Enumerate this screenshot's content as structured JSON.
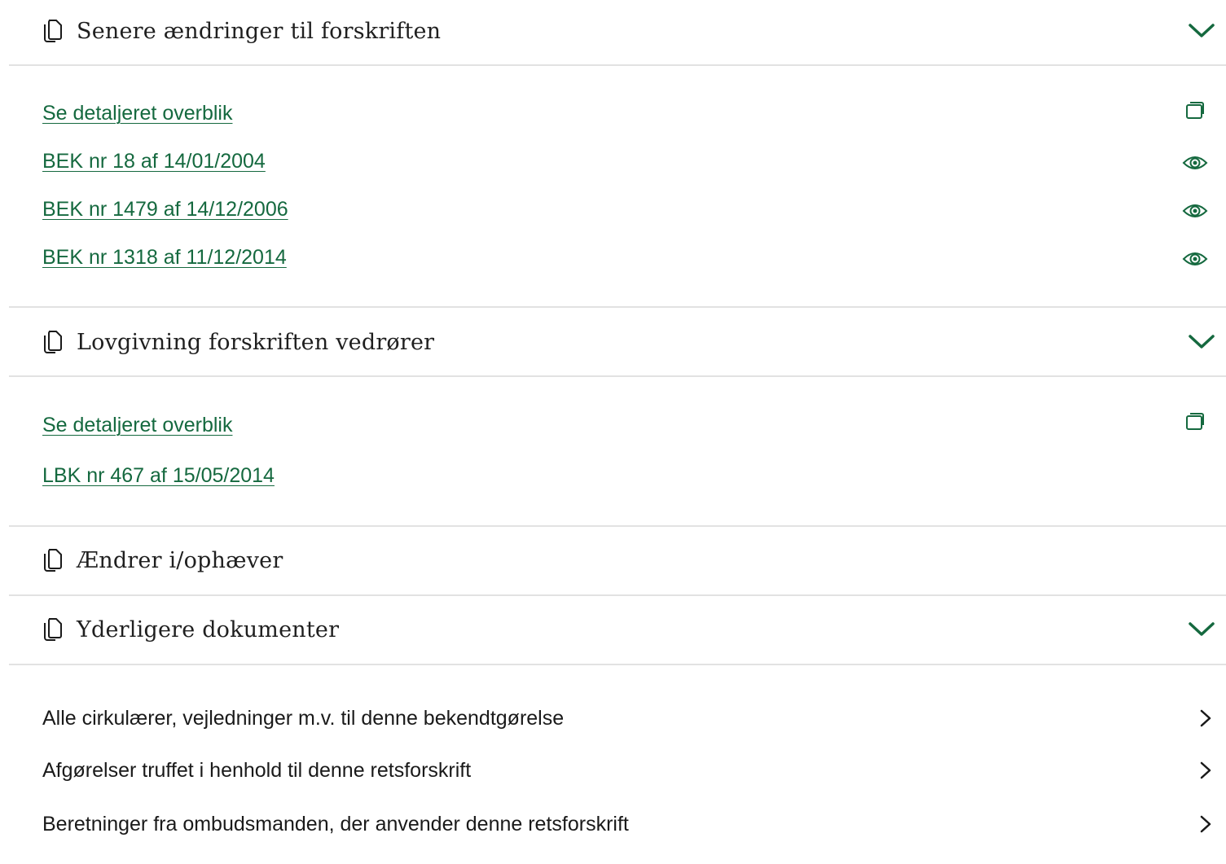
{
  "colors": {
    "accent": "#15693f",
    "divider": "#e2e2e2",
    "text": "#1a1a1a"
  },
  "sections": [
    {
      "title": "Senere ændringer til forskriften",
      "icon": "copy-document-icon",
      "expanded": true,
      "links": [
        {
          "label": "Se detaljeret overblik",
          "icon": "copy-icon"
        },
        {
          "label": "BEK nr 18 af 14/01/2004",
          "icon": "eye-icon"
        },
        {
          "label": "BEK nr 1479 af 14/12/2006",
          "icon": "eye-icon"
        },
        {
          "label": "BEK nr 1318 af 11/12/2014",
          "icon": "eye-icon"
        }
      ]
    },
    {
      "title": "Lovgivning forskriften vedrører",
      "icon": "copy-document-icon",
      "expanded": true,
      "links": [
        {
          "label": "Se detaljeret overblik",
          "icon": "copy-icon"
        },
        {
          "label": "LBK nr 467 af 15/05/2014",
          "icon": ""
        }
      ]
    },
    {
      "title": "Ændrer i/ophæver",
      "icon": "copy-document-icon",
      "expanded": false,
      "links": []
    },
    {
      "title": "Yderligere dokumenter",
      "icon": "copy-document-icon",
      "expanded": true,
      "items": [
        {
          "label": "Alle cirkulærer, vejledninger m.v. til denne bekendtgørelse",
          "icon": "chevron-right-icon"
        },
        {
          "label": "Afgørelser truffet i henhold til denne retsforskrift",
          "icon": "chevron-right-icon"
        },
        {
          "label": "Beretninger fra ombudsmanden, der anvender denne retsforskrift",
          "icon": "chevron-right-icon"
        }
      ]
    }
  ]
}
